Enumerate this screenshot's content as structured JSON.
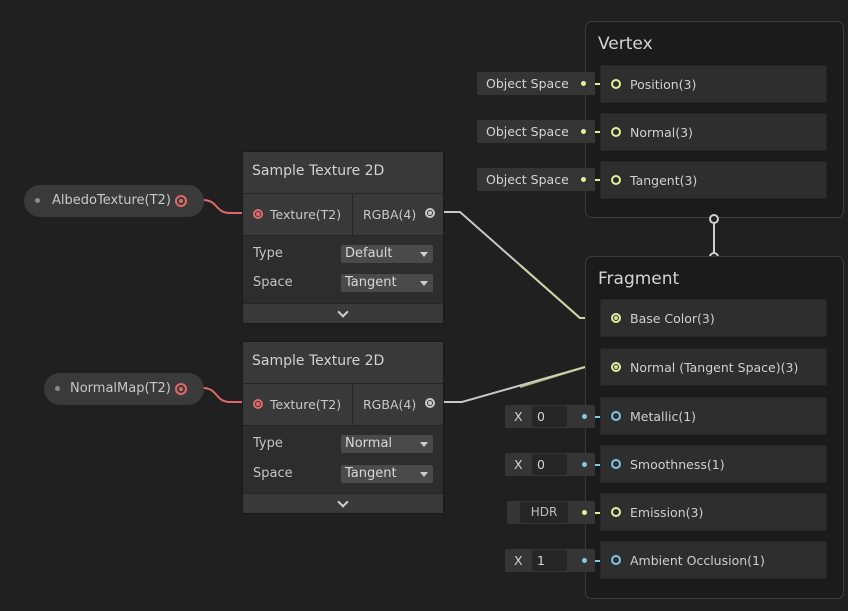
{
  "properties": [
    {
      "label": "AlbedoTexture(T2)"
    },
    {
      "label": "NormalMap(T2)"
    }
  ],
  "sample_nodes": [
    {
      "title": "Sample Texture 2D",
      "input_label": "Texture(T2)",
      "output_label": "RGBA(4)",
      "type_label": "Type",
      "type_value": "Default",
      "space_label": "Space",
      "space_value": "Tangent"
    },
    {
      "title": "Sample Texture 2D",
      "input_label": "Texture(T2)",
      "output_label": "RGBA(4)",
      "type_label": "Type",
      "type_value": "Normal",
      "space_label": "Space",
      "space_value": "Tangent"
    }
  ],
  "vertex": {
    "title": "Vertex",
    "blocks": [
      {
        "label": "Position(3)",
        "input": "Object Space"
      },
      {
        "label": "Normal(3)",
        "input": "Object Space"
      },
      {
        "label": "Tangent(3)",
        "input": "Object Space"
      }
    ]
  },
  "fragment": {
    "title": "Fragment",
    "blocks": [
      {
        "label": "Base Color(3)"
      },
      {
        "label": "Normal (Tangent Space)(3)"
      },
      {
        "label": "Metallic(1)",
        "axis": "X",
        "value": "0"
      },
      {
        "label": "Smoothness(1)",
        "axis": "X",
        "value": "0"
      },
      {
        "label": "Emission(3)",
        "mode": "HDR"
      },
      {
        "label": "Ambient Occlusion(1)",
        "axis": "X",
        "value": "1"
      }
    ]
  },
  "colors": {
    "texture_port": "#e06a6a",
    "vector3_port": "#e4ef9a",
    "float_port": "#7ec9e0",
    "rgba_wire": "#c8c8c8"
  }
}
